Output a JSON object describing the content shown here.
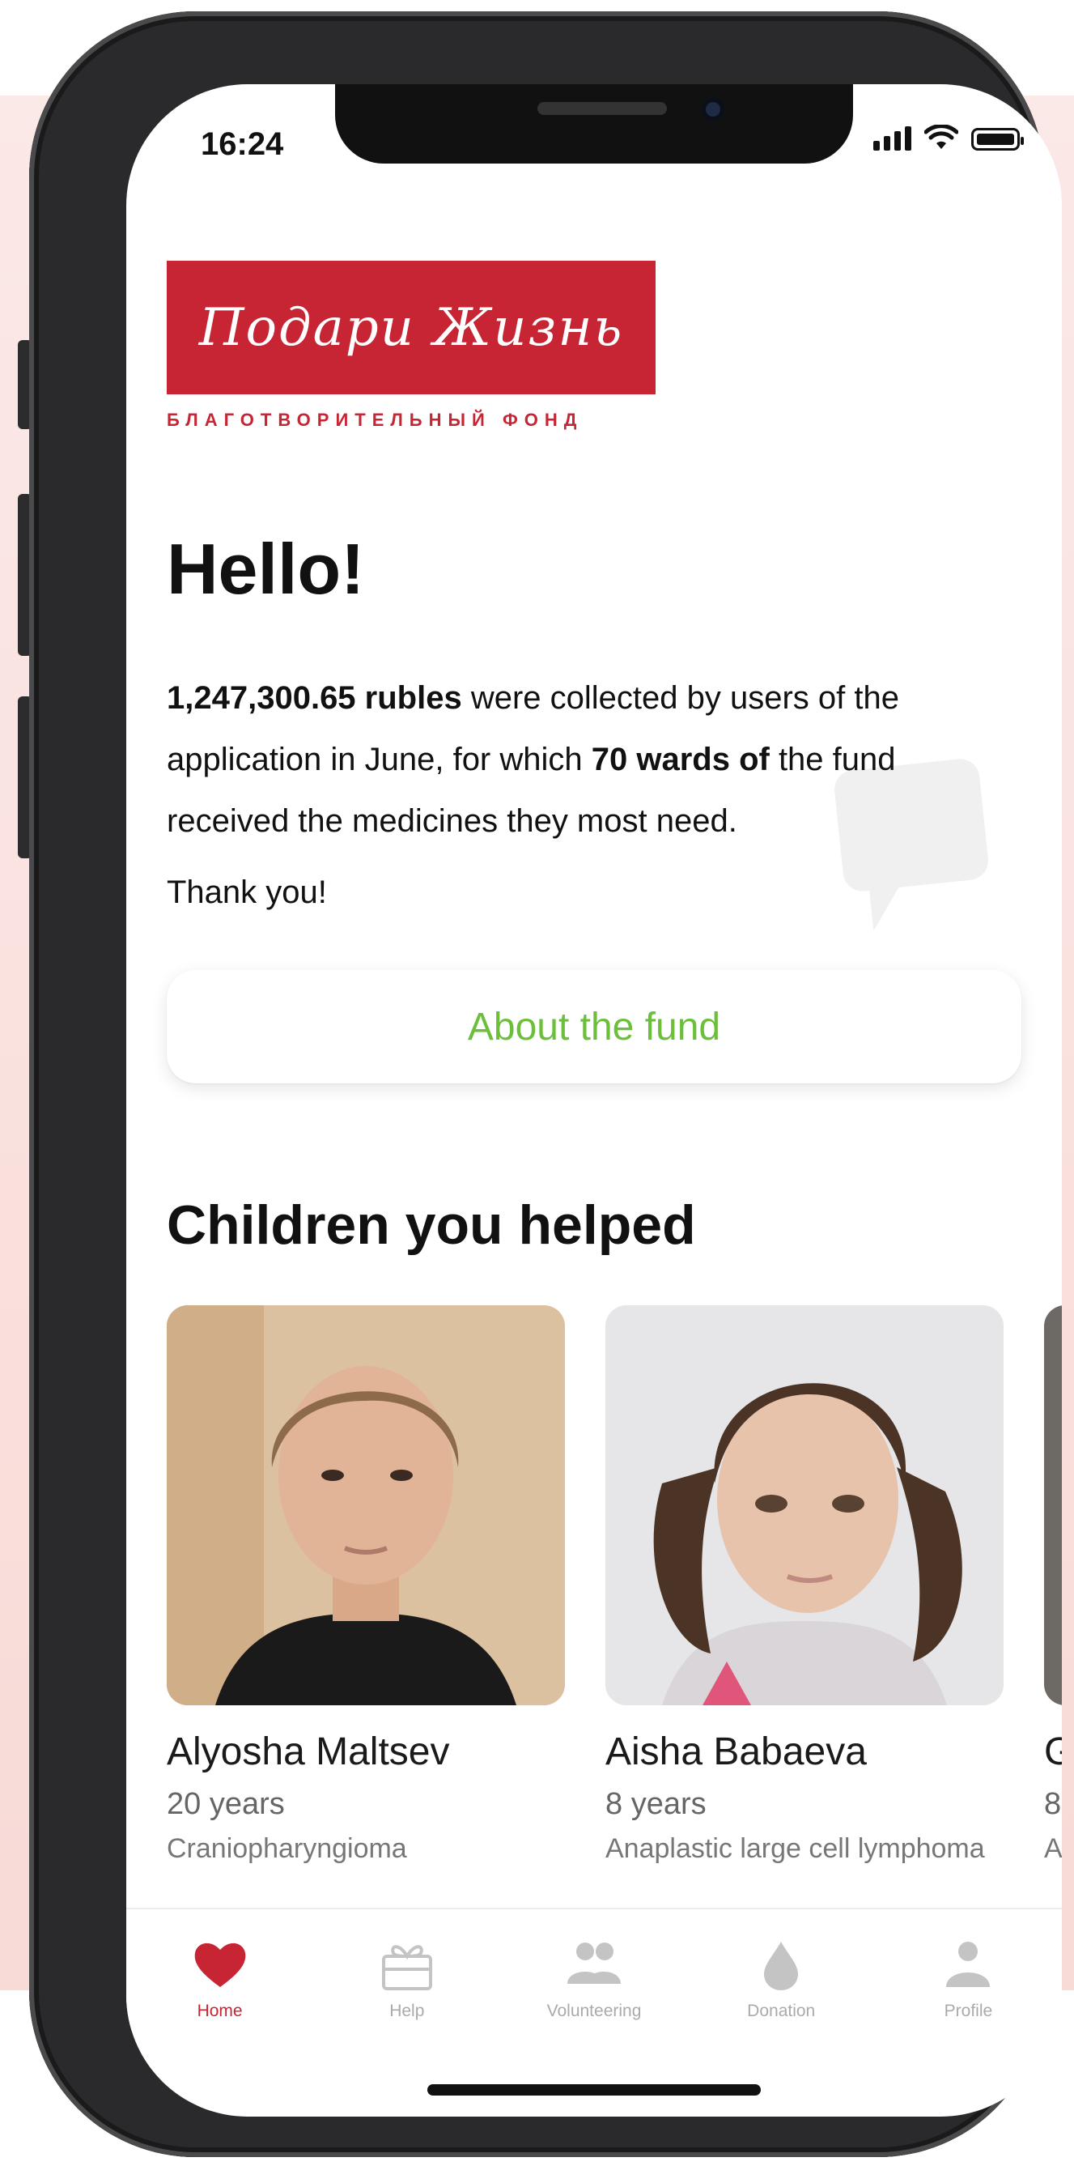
{
  "status_bar": {
    "time": "16:24"
  },
  "logo": {
    "script_text": "Подари Жизнь",
    "subtitle": "БЛАГОТВОРИТЕЛЬНЫЙ ФОНД",
    "brand_color": "#c72534"
  },
  "greeting": {
    "title": "Hello!",
    "amount": "1,247,300.65 rubles",
    "text_part1": " were collected by users of the application in June, for which ",
    "wards": "70 wards of",
    "text_part2": " the fund received the medicines they most need.",
    "thanks": "Thank you!"
  },
  "about_button": {
    "label": "About the fund",
    "color": "#6cbf3a"
  },
  "children_section": {
    "title": "Children you helped",
    "children": [
      {
        "name": "Alyosha Maltsev",
        "age": "20 years",
        "diagnosis": "Craniopharyngioma"
      },
      {
        "name": "Aisha Babaeva",
        "age": "8 years",
        "diagnosis": "Anaplastic large cell lymphoma"
      },
      {
        "name": "G",
        "age": "8",
        "diagnosis": "A"
      }
    ]
  },
  "tabbar": {
    "tabs": [
      {
        "label": "Home",
        "icon": "heart-icon",
        "active": true
      },
      {
        "label": "Help",
        "icon": "gift-icon",
        "active": false
      },
      {
        "label": "Volunteering",
        "icon": "people-icon",
        "active": false
      },
      {
        "label": "Donation",
        "icon": "drop-icon",
        "active": false
      },
      {
        "label": "Profile",
        "icon": "person-icon",
        "active": false
      }
    ]
  }
}
